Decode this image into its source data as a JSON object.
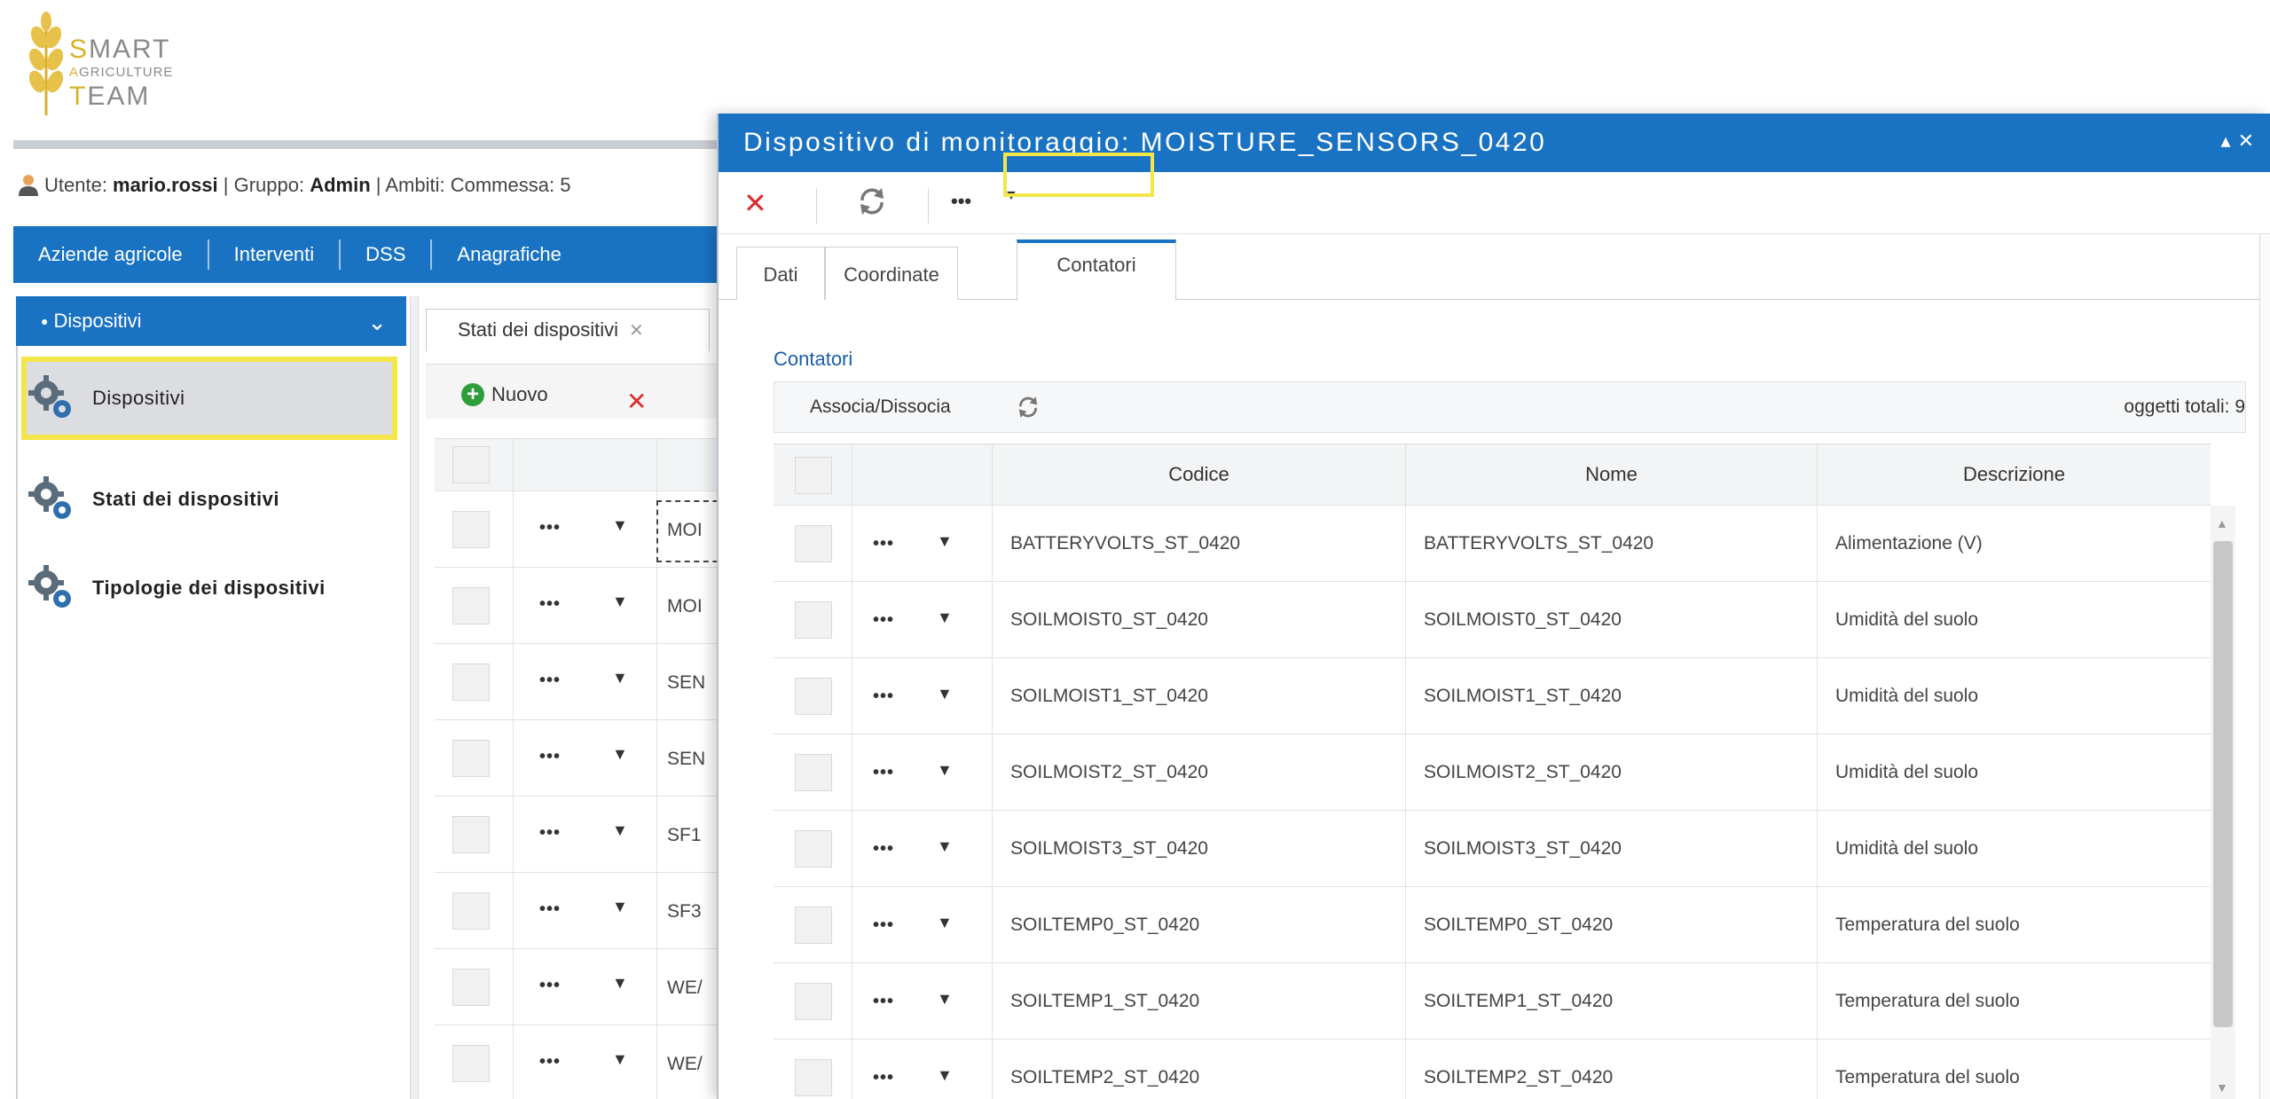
{
  "logo": {
    "line1_cap": "S",
    "line1_rest": "MART",
    "line2_cap": "A",
    "line2_rest": "GRICULTURE",
    "line3_cap": "T",
    "line3_rest": "EAM"
  },
  "user_bar": {
    "prefix": "Utente: ",
    "username": "mario.rossi",
    "group_prefix": " | Gruppo: ",
    "group": "Admin",
    "scope_text": " | Ambiti: Commessa: 5"
  },
  "main_nav": [
    "Aziende agricole",
    "Interventi",
    "DSS",
    "Anagrafiche"
  ],
  "sidebar": {
    "header": "Dispositivi",
    "items": [
      {
        "label": "Dispositivi",
        "icon": "gears-icon",
        "active": true
      },
      {
        "label": "Stati dei dispositivi",
        "icon": "gears-icon"
      },
      {
        "label": "Tipologie dei dispositivi",
        "icon": "gears-icon"
      }
    ]
  },
  "background_panel": {
    "tab_label": "Stati dei dispositivi",
    "new_label": "Nuovo",
    "rows": [
      "MOI",
      "MOI",
      "SEN",
      "SEN",
      "SF1",
      "SF3",
      "WE/",
      "WE/"
    ]
  },
  "modal": {
    "title": "Dispositivo di monitoraggio: MOISTURE_SENSORS_0420",
    "more_label": "•••",
    "tabs": [
      "Dati",
      "Coordinate",
      "Contatori"
    ],
    "active_tab": "Contatori",
    "section_label": "Contatori",
    "toolbar": {
      "assoc_label": "Associa/Dissocia",
      "total_label": "oggetti totali: 9"
    },
    "columns": [
      "Codice",
      "Nome",
      "Descrizione"
    ],
    "rows": [
      {
        "codice": "BATTERYVOLTS_ST_0420",
        "nome": "BATTERYVOLTS_ST_0420",
        "descrizione": "Alimentazione (V)"
      },
      {
        "codice": "SOILMOIST0_ST_0420",
        "nome": "SOILMOIST0_ST_0420",
        "descrizione": "Umidità del suolo"
      },
      {
        "codice": "SOILMOIST1_ST_0420",
        "nome": "SOILMOIST1_ST_0420",
        "descrizione": "Umidità del suolo"
      },
      {
        "codice": "SOILMOIST2_ST_0420",
        "nome": "SOILMOIST2_ST_0420",
        "descrizione": "Umidità del suolo"
      },
      {
        "codice": "SOILMOIST3_ST_0420",
        "nome": "SOILMOIST3_ST_0420",
        "descrizione": "Umidità del suolo"
      },
      {
        "codice": "SOILTEMP0_ST_0420",
        "nome": "SOILTEMP0_ST_0420",
        "descrizione": "Temperatura del suolo"
      },
      {
        "codice": "SOILTEMP1_ST_0420",
        "nome": "SOILTEMP1_ST_0420",
        "descrizione": "Temperatura del suolo"
      },
      {
        "codice": "SOILTEMP2_ST_0420",
        "nome": "SOILTEMP2_ST_0420",
        "descrizione": "Temperatura del suolo"
      }
    ]
  },
  "colors": {
    "primary_blue": "#1a73c2",
    "highlight_yellow": "#f3e64a",
    "delete_red": "#d62f2f",
    "add_green": "#2e9e3a"
  }
}
